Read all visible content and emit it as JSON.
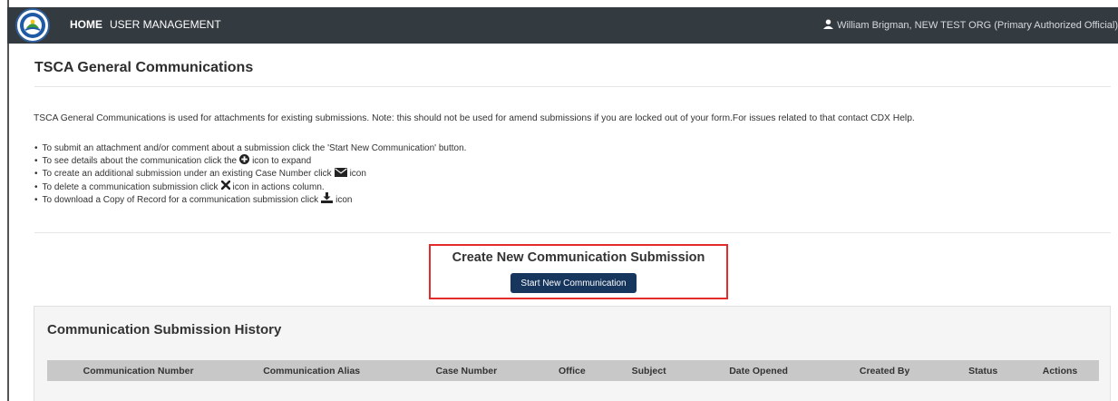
{
  "navbar": {
    "home_label": "HOME",
    "user_mgmt_label": "USER MANAGEMENT",
    "user_info": "William Brigman, NEW TEST ORG (Primary Authorized Official)"
  },
  "page": {
    "title": "TSCA General Communications",
    "intro": "TSCA General Communications is used for attachments for existing submissions. Note: this should not be used for amend submissions if you are locked out of your form.For issues related to that contact CDX Help.",
    "instructions": [
      {
        "before": "To submit an attachment and/or comment about a submission click the 'Start New Communication' button.",
        "icon": "",
        "after": ""
      },
      {
        "before": "To see details about the communication click the",
        "icon": "plus-circle-icon",
        "after": "icon to expand"
      },
      {
        "before": "To create an additional submission under an existing Case Number click",
        "icon": "envelope-icon",
        "after": "icon"
      },
      {
        "before": "To delete a communication submission click",
        "icon": "x-icon",
        "after": "icon in actions column."
      },
      {
        "before": "To download a Copy of Record for a communication submission click",
        "icon": "download-icon",
        "after": "icon"
      }
    ]
  },
  "create": {
    "title": "Create New Communication Submission",
    "button_label": "Start New Communication"
  },
  "history": {
    "title": "Communication Submission History",
    "columns": [
      "Communication Number",
      "Communication Alias",
      "Case Number",
      "Office",
      "Subject",
      "Date Opened",
      "Created By",
      "Status",
      "Actions"
    ]
  },
  "colors": {
    "navbar_bg": "#333a40",
    "button_bg": "#17365d",
    "highlight_border": "#e32b2b",
    "table_header_bg": "#c8c8c8"
  }
}
